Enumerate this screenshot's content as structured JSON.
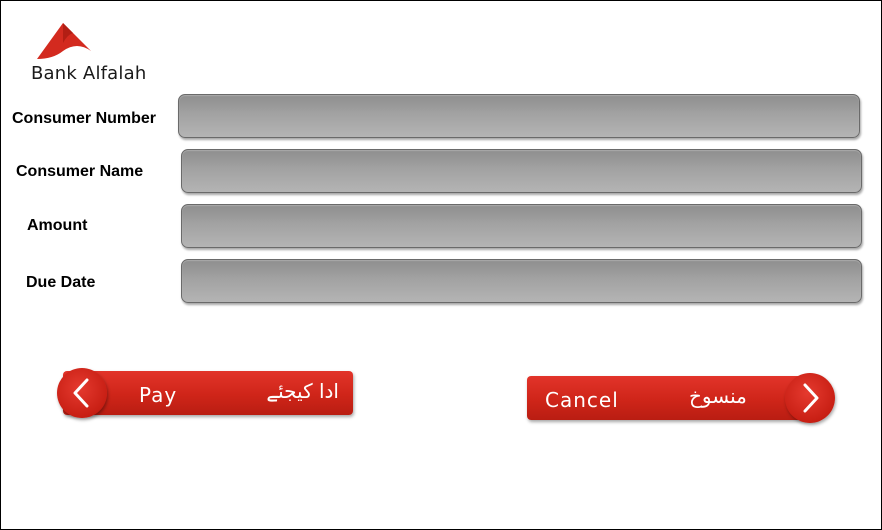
{
  "brand": {
    "name": "Bank Alfalah",
    "accent_color": "#d32a1f"
  },
  "form": {
    "fields": [
      {
        "label": "Consumer Number",
        "value": ""
      },
      {
        "label": "Consumer Name",
        "value": ""
      },
      {
        "label": "Amount",
        "value": ""
      },
      {
        "label": "Due Date",
        "value": ""
      }
    ]
  },
  "actions": {
    "pay": {
      "label": "Pay",
      "urdu_label": "ادا کیجئے",
      "icon": "chevron-left-icon"
    },
    "cancel": {
      "label": "Cancel",
      "urdu_label": "منسوخ",
      "icon": "chevron-right-icon"
    }
  }
}
